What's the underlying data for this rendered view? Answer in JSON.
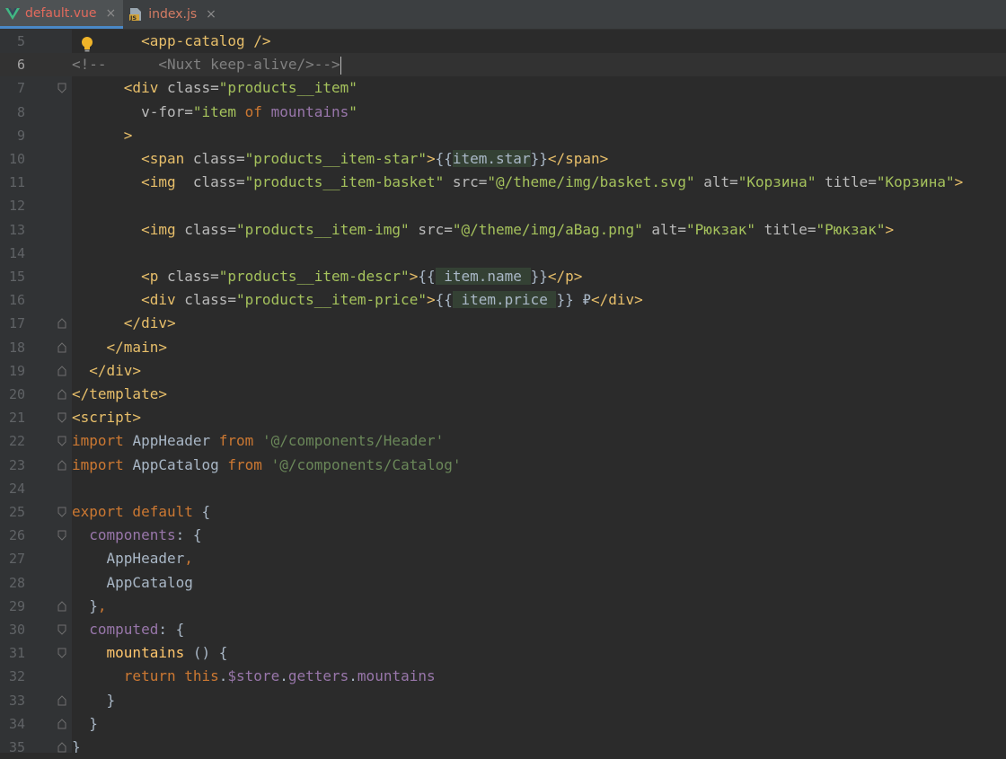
{
  "tabs": [
    {
      "label": "default.vue",
      "close": "×",
      "icon": "vue-icon",
      "active": true
    },
    {
      "label": "index.js",
      "close": "×",
      "icon": "js-file-icon",
      "active": false
    }
  ],
  "js_icon_text": "JS",
  "lines": [
    {
      "n": "5",
      "segs": [
        [
          "",
          "        "
        ],
        [
          "tag",
          "<app-catalog />"
        ]
      ]
    },
    {
      "n": "6",
      "segs": [
        [
          "comment",
          "<!--      <Nuxt keep-alive/>-->"
        ]
      ]
    },
    {
      "n": "7",
      "segs": [
        [
          "",
          "      "
        ],
        [
          "tag",
          "<div "
        ],
        [
          "attr",
          "class="
        ],
        [
          "str",
          "\"products__item\""
        ]
      ]
    },
    {
      "n": "8",
      "segs": [
        [
          "",
          "        "
        ],
        [
          "attr",
          "v-for="
        ],
        [
          "str",
          "\"item "
        ],
        [
          "kw",
          "of"
        ],
        [
          "str",
          " "
        ],
        [
          "prop",
          "mountains"
        ],
        [
          "str",
          "\""
        ]
      ]
    },
    {
      "n": "9",
      "segs": [
        [
          "",
          "      "
        ],
        [
          "tag",
          ">"
        ]
      ]
    },
    {
      "n": "10",
      "segs": [
        [
          "",
          "        "
        ],
        [
          "tag",
          "<span "
        ],
        [
          "attr",
          "class="
        ],
        [
          "str",
          "\"products__item-star\""
        ],
        [
          "tag",
          ">"
        ],
        [
          "ident",
          "{{"
        ],
        [
          "hl",
          "item."
        ],
        [
          "hlprop",
          "star"
        ],
        [
          "ident",
          "}}"
        ],
        [
          "tag",
          "</span>"
        ]
      ]
    },
    {
      "n": "11",
      "segs": [
        [
          "",
          "        "
        ],
        [
          "tag",
          "<img  "
        ],
        [
          "attr",
          "class="
        ],
        [
          "str",
          "\"products__item-basket\""
        ],
        [
          "",
          " "
        ],
        [
          "attr",
          "src="
        ],
        [
          "str",
          "\"@/theme/img/basket.svg\""
        ],
        [
          "",
          " "
        ],
        [
          "attr",
          "alt="
        ],
        [
          "str",
          "\"Корзина\""
        ],
        [
          "",
          " "
        ],
        [
          "attr",
          "title="
        ],
        [
          "str",
          "\"Корзина\""
        ],
        [
          "tag",
          ">"
        ]
      ]
    },
    {
      "n": "12",
      "segs": []
    },
    {
      "n": "13",
      "segs": [
        [
          "",
          "        "
        ],
        [
          "tag",
          "<img "
        ],
        [
          "attr",
          "class="
        ],
        [
          "str",
          "\"products__item-img\""
        ],
        [
          "",
          " "
        ],
        [
          "attr",
          "src="
        ],
        [
          "str",
          "\"@/theme/img/aBag.png\""
        ],
        [
          "",
          " "
        ],
        [
          "attr",
          "alt="
        ],
        [
          "str",
          "\"Рюкзак\""
        ],
        [
          "",
          " "
        ],
        [
          "attr",
          "title="
        ],
        [
          "str",
          "\"Рюкзак\""
        ],
        [
          "tag",
          ">"
        ]
      ]
    },
    {
      "n": "14",
      "segs": []
    },
    {
      "n": "15",
      "segs": [
        [
          "",
          "        "
        ],
        [
          "tag",
          "<p "
        ],
        [
          "attr",
          "class="
        ],
        [
          "str",
          "\"products__item-descr\""
        ],
        [
          "tag",
          ">"
        ],
        [
          "ident",
          "{{"
        ],
        [
          "hl",
          " item."
        ],
        [
          "hlprop",
          "name "
        ],
        [
          "ident",
          "}}"
        ],
        [
          "tag",
          "</p>"
        ]
      ]
    },
    {
      "n": "16",
      "segs": [
        [
          "",
          "        "
        ],
        [
          "tag",
          "<div "
        ],
        [
          "attr",
          "class="
        ],
        [
          "str",
          "\"products__item-price\""
        ],
        [
          "tag",
          ">"
        ],
        [
          "ident",
          "{{"
        ],
        [
          "hl",
          " item."
        ],
        [
          "hlprop",
          "price "
        ],
        [
          "ident",
          "}} ₽"
        ],
        [
          "tag",
          "</div>"
        ]
      ]
    },
    {
      "n": "17",
      "segs": [
        [
          "",
          "      "
        ],
        [
          "tag",
          "</div>"
        ]
      ]
    },
    {
      "n": "18",
      "segs": [
        [
          "",
          "    "
        ],
        [
          "tag",
          "</main>"
        ]
      ]
    },
    {
      "n": "19",
      "segs": [
        [
          "",
          "  "
        ],
        [
          "tag",
          "</div>"
        ]
      ]
    },
    {
      "n": "20",
      "segs": [
        [
          "tag",
          "</template>"
        ]
      ]
    },
    {
      "n": "21",
      "segs": [
        [
          "tag",
          "<script>"
        ]
      ]
    },
    {
      "n": "22",
      "segs": [
        [
          "kw",
          "import "
        ],
        [
          "ident",
          "AppHeader "
        ],
        [
          "kw",
          "from "
        ],
        [
          "strpath",
          "'@/components/Header'"
        ]
      ]
    },
    {
      "n": "23",
      "segs": [
        [
          "kw",
          "import "
        ],
        [
          "ident",
          "AppCatalog "
        ],
        [
          "kw",
          "from "
        ],
        [
          "strpath",
          "'@/components/Catalog'"
        ]
      ]
    },
    {
      "n": "24",
      "segs": []
    },
    {
      "n": "25",
      "segs": [
        [
          "kw",
          "export default "
        ],
        [
          "ident",
          "{"
        ]
      ]
    },
    {
      "n": "26",
      "segs": [
        [
          "",
          "  "
        ],
        [
          "prop",
          "components"
        ],
        [
          "ident",
          ": {"
        ]
      ]
    },
    {
      "n": "27",
      "segs": [
        [
          "",
          "    "
        ],
        [
          "ident",
          "AppHeader"
        ],
        [
          "kw",
          ","
        ]
      ]
    },
    {
      "n": "28",
      "segs": [
        [
          "",
          "    "
        ],
        [
          "ident",
          "AppCatalog"
        ]
      ]
    },
    {
      "n": "29",
      "segs": [
        [
          "",
          "  "
        ],
        [
          "ident",
          "}"
        ],
        [
          "kw",
          ","
        ]
      ]
    },
    {
      "n": "30",
      "segs": [
        [
          "",
          "  "
        ],
        [
          "prop",
          "computed"
        ],
        [
          "ident",
          ": {"
        ]
      ]
    },
    {
      "n": "31",
      "segs": [
        [
          "",
          "    "
        ],
        [
          "fn",
          "mountains "
        ],
        [
          "ident",
          "() {"
        ]
      ]
    },
    {
      "n": "32",
      "segs": [
        [
          "",
          "      "
        ],
        [
          "kw",
          "return this"
        ],
        [
          "ident",
          "."
        ],
        [
          "prop",
          "$store"
        ],
        [
          "ident",
          "."
        ],
        [
          "prop",
          "getters"
        ],
        [
          "ident",
          "."
        ],
        [
          "prop",
          "mountains"
        ]
      ]
    },
    {
      "n": "33",
      "segs": [
        [
          "",
          "    "
        ],
        [
          "ident",
          "}"
        ]
      ]
    },
    {
      "n": "34",
      "segs": [
        [
          "",
          "  "
        ],
        [
          "ident",
          "}"
        ]
      ]
    },
    {
      "n": "35",
      "segs": [
        [
          "ident",
          "}"
        ]
      ]
    }
  ],
  "current_line": "6",
  "fold_lines": [
    "7",
    "17",
    "18",
    "19",
    "20",
    "21",
    "22",
    "23",
    "25",
    "26",
    "29",
    "30",
    "31",
    "33",
    "34",
    "35"
  ],
  "fold_kind": {
    "7": "open",
    "17": "close",
    "18": "close",
    "19": "close",
    "20": "close",
    "21": "open",
    "22": "open",
    "23": "close",
    "25": "open",
    "26": "open",
    "29": "close",
    "30": "open",
    "31": "open",
    "33": "close",
    "34": "close",
    "35": "close"
  },
  "bulb_line": "5",
  "bulb_icon": "lightbulb-icon"
}
